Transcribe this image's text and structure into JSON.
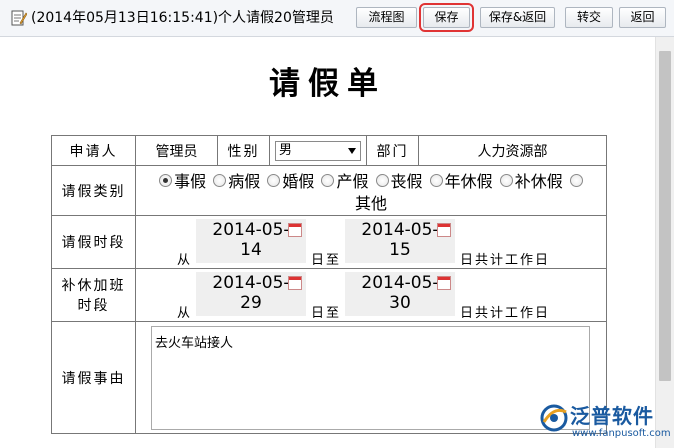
{
  "window": {
    "title": "(2014年05月13日16:15:41)个人请假20管理员"
  },
  "toolbar": {
    "buttons": [
      {
        "label": "流程图"
      },
      {
        "label": "保存"
      },
      {
        "label": "保存&返回"
      },
      {
        "label": "转交"
      },
      {
        "label": "返回"
      }
    ]
  },
  "form": {
    "title": "请假单",
    "applicant_label": "申请人",
    "applicant_value": "管理员",
    "gender_label": "性别",
    "gender_value": "男",
    "department_label": "部门",
    "department_value": "人力资源部",
    "leave_type_label": "请假类别",
    "leave_types": [
      "事假",
      "病假",
      "婚假",
      "产假",
      "丧假",
      "年休假",
      "补休假",
      "其他"
    ],
    "leave_type_selected": "事假",
    "leave_period_label": "请假时段",
    "from_label": "从",
    "to_label": "日至",
    "total_label": "日共计工作日",
    "leave_from": {
      "line1": "2014-05-",
      "line2": "14"
    },
    "leave_to": {
      "line1": "2014-05-",
      "line2": "15"
    },
    "comp_label_line1": "补休加班",
    "comp_label_line2": "时段",
    "comp_from": {
      "line1": "2014-05-",
      "line2": "29"
    },
    "comp_to": {
      "line1": "2014-05-",
      "line2": "30"
    },
    "reason_label": "请假事由",
    "reason_value": "去火车站接人"
  },
  "logo": {
    "name": "泛普软件",
    "url": "www.fanpusoft.com"
  },
  "colors": {
    "brand": "#1a5aa0",
    "highlight": "#e03434"
  }
}
